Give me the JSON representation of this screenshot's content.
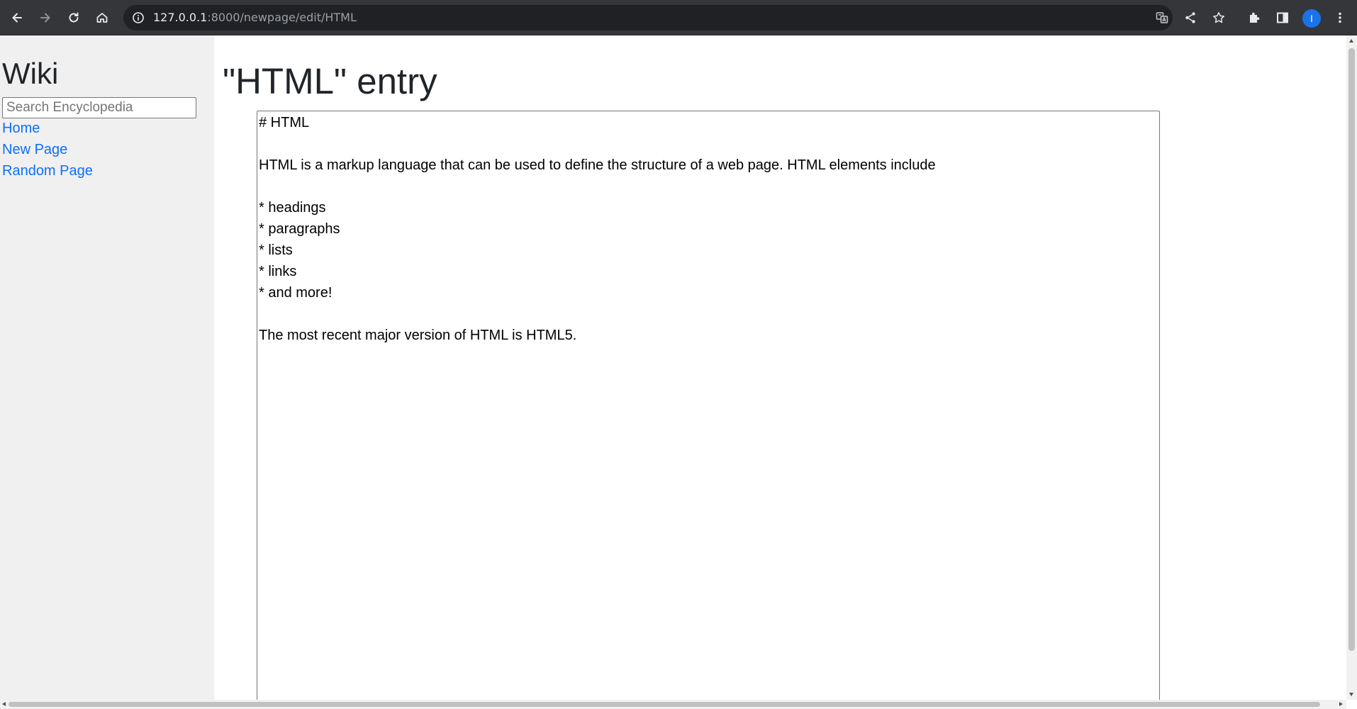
{
  "browser": {
    "url_host": "127.0.0.1",
    "url_path": ":8000/newpage/edit/HTML",
    "profile_initial": "I"
  },
  "sidebar": {
    "title": "Wiki",
    "search": {
      "placeholder": "Search Encyclopedia",
      "value": ""
    },
    "links": [
      {
        "label": "Home"
      },
      {
        "label": "New Page"
      },
      {
        "label": "Random Page"
      }
    ]
  },
  "main": {
    "title": "\"HTML\" entry",
    "content": "# HTML\n\nHTML is a markup language that can be used to define the structure of a web page. HTML elements include\n\n* headings\n* paragraphs\n* lists\n* links\n* and more!\n\nThe most recent major version of HTML is HTML5."
  },
  "colors": {
    "toolbar": "#35363a",
    "omnibox": "#202124",
    "sidebar": "#f0f0f0",
    "link": "#0d6efd",
    "avatar": "#1a73e8"
  }
}
